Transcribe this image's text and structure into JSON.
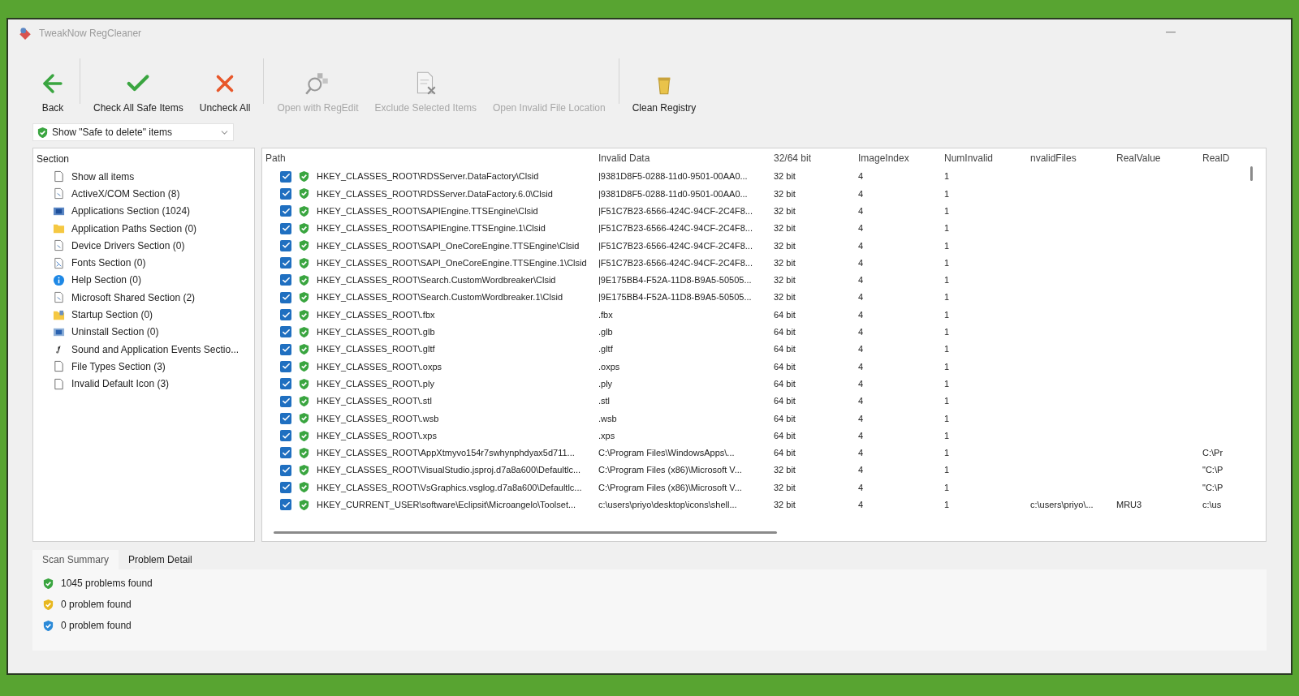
{
  "window": {
    "title": "TweakNow RegCleaner"
  },
  "toolbar": [
    {
      "label": "Back",
      "disabled": false
    },
    {
      "label": "Check All Safe Items",
      "disabled": false
    },
    {
      "label": "Uncheck All",
      "disabled": false
    },
    {
      "label": "Open with RegEdit",
      "disabled": true
    },
    {
      "label": "Exclude Selected Items",
      "disabled": true
    },
    {
      "label": "Open Invalid File Location",
      "disabled": true
    },
    {
      "label": "Clean Registry",
      "disabled": false
    }
  ],
  "filter": {
    "value": "Show \"Safe to delete\" items"
  },
  "sections": {
    "header": "Section",
    "items": [
      {
        "label": "Show all items"
      },
      {
        "label": "ActiveX/COM Section (8)"
      },
      {
        "label": "Applications Section (1024)"
      },
      {
        "label": "Application Paths Section (0)"
      },
      {
        "label": "Device Drivers Section (0)"
      },
      {
        "label": "Fonts Section (0)"
      },
      {
        "label": "Help Section (0)"
      },
      {
        "label": "Microsoft Shared Section (2)"
      },
      {
        "label": "Startup Section (0)"
      },
      {
        "label": "Uninstall Section (0)"
      },
      {
        "label": "Sound and Application Events Sectio..."
      },
      {
        "label": "File Types Section (3)"
      },
      {
        "label": "Invalid Default Icon (3)"
      }
    ]
  },
  "table": {
    "columns": [
      "Path",
      "Invalid Data",
      "32/64 bit",
      "ImageIndex",
      "NumInvalid",
      "nvalidFiles",
      "RealValue",
      "RealD"
    ],
    "rows": [
      {
        "checked": true,
        "path": "HKEY_CLASSES_ROOT\\RDSServer.DataFactory\\Clsid",
        "invalid_data": "|9381D8F5-0288-11d0-9501-00AA0...",
        "bitness": "32 bit",
        "image_index": "4",
        "num_invalid": "1"
      },
      {
        "checked": true,
        "path": "HKEY_CLASSES_ROOT\\RDSServer.DataFactory.6.0\\Clsid",
        "invalid_data": "|9381D8F5-0288-11d0-9501-00AA0...",
        "bitness": "32 bit",
        "image_index": "4",
        "num_invalid": "1"
      },
      {
        "checked": true,
        "path": "HKEY_CLASSES_ROOT\\SAPIEngine.TTSEngine\\Clsid",
        "invalid_data": "|F51C7B23-6566-424C-94CF-2C4F8...",
        "bitness": "32 bit",
        "image_index": "4",
        "num_invalid": "1"
      },
      {
        "checked": true,
        "path": "HKEY_CLASSES_ROOT\\SAPIEngine.TTSEngine.1\\Clsid",
        "invalid_data": "|F51C7B23-6566-424C-94CF-2C4F8...",
        "bitness": "32 bit",
        "image_index": "4",
        "num_invalid": "1"
      },
      {
        "checked": true,
        "path": "HKEY_CLASSES_ROOT\\SAPI_OneCoreEngine.TTSEngine\\Clsid",
        "invalid_data": "|F51C7B23-6566-424C-94CF-2C4F8...",
        "bitness": "32 bit",
        "image_index": "4",
        "num_invalid": "1"
      },
      {
        "checked": true,
        "path": "HKEY_CLASSES_ROOT\\SAPI_OneCoreEngine.TTSEngine.1\\Clsid",
        "invalid_data": "|F51C7B23-6566-424C-94CF-2C4F8...",
        "bitness": "32 bit",
        "image_index": "4",
        "num_invalid": "1"
      },
      {
        "checked": true,
        "path": "HKEY_CLASSES_ROOT\\Search.CustomWordbreaker\\Clsid",
        "invalid_data": "|9E175BB4-F52A-11D8-B9A5-50505...",
        "bitness": "32 bit",
        "image_index": "4",
        "num_invalid": "1"
      },
      {
        "checked": true,
        "path": "HKEY_CLASSES_ROOT\\Search.CustomWordbreaker.1\\Clsid",
        "invalid_data": "|9E175BB4-F52A-11D8-B9A5-50505...",
        "bitness": "32 bit",
        "image_index": "4",
        "num_invalid": "1"
      },
      {
        "checked": true,
        "path": "HKEY_CLASSES_ROOT\\.fbx",
        "invalid_data": ".fbx",
        "bitness": "64 bit",
        "image_index": "4",
        "num_invalid": "1"
      },
      {
        "checked": true,
        "path": "HKEY_CLASSES_ROOT\\.glb",
        "invalid_data": ".glb",
        "bitness": "64 bit",
        "image_index": "4",
        "num_invalid": "1"
      },
      {
        "checked": true,
        "path": "HKEY_CLASSES_ROOT\\.gltf",
        "invalid_data": ".gltf",
        "bitness": "64 bit",
        "image_index": "4",
        "num_invalid": "1"
      },
      {
        "checked": true,
        "path": "HKEY_CLASSES_ROOT\\.oxps",
        "invalid_data": ".oxps",
        "bitness": "64 bit",
        "image_index": "4",
        "num_invalid": "1"
      },
      {
        "checked": true,
        "path": "HKEY_CLASSES_ROOT\\.ply",
        "invalid_data": ".ply",
        "bitness": "64 bit",
        "image_index": "4",
        "num_invalid": "1"
      },
      {
        "checked": true,
        "path": "HKEY_CLASSES_ROOT\\.stl",
        "invalid_data": ".stl",
        "bitness": "64 bit",
        "image_index": "4",
        "num_invalid": "1"
      },
      {
        "checked": true,
        "path": "HKEY_CLASSES_ROOT\\.wsb",
        "invalid_data": ".wsb",
        "bitness": "64 bit",
        "image_index": "4",
        "num_invalid": "1"
      },
      {
        "checked": true,
        "path": "HKEY_CLASSES_ROOT\\.xps",
        "invalid_data": ".xps",
        "bitness": "64 bit",
        "image_index": "4",
        "num_invalid": "1"
      },
      {
        "checked": true,
        "path": "HKEY_CLASSES_ROOT\\AppXtmyvo154r7swhynphdyax5d711...",
        "invalid_data": "C:\\Program Files\\WindowsApps\\...",
        "bitness": "64 bit",
        "image_index": "4",
        "num_invalid": "1",
        "column_8": "C:\\Pr"
      },
      {
        "checked": true,
        "path": "HKEY_CLASSES_ROOT\\VisualStudio.jsproj.d7a8a600\\Defaultlc...",
        "invalid_data": "C:\\Program Files (x86)\\Microsoft V...",
        "bitness": "32 bit",
        "image_index": "4",
        "num_invalid": "1",
        "column_8": "\"C:\\P"
      },
      {
        "checked": true,
        "path": "HKEY_CLASSES_ROOT\\VsGraphics.vsglog.d7a8a600\\Defaultlc...",
        "invalid_data": "C:\\Program Files (x86)\\Microsoft V...",
        "bitness": "32 bit",
        "image_index": "4",
        "num_invalid": "1",
        "column_8": "\"C:\\P"
      },
      {
        "checked": true,
        "path": "HKEY_CURRENT_USER\\software\\Eclipsit\\Microangelo\\Toolset...",
        "invalid_data": "c:\\users\\priyo\\desktop\\icons\\shell...",
        "bitness": "32 bit",
        "image_index": "4",
        "num_invalid": "1",
        "invalid_files": "c:\\users\\priyo\\...",
        "real_value": "MRU3",
        "column_8": "c:\\us"
      }
    ]
  },
  "bottom_tabs": [
    {
      "label": "Scan Summary",
      "selected": true
    },
    {
      "label": "Problem Detail",
      "selected": false
    }
  ],
  "summary": [
    {
      "kind": "safe",
      "text": "1045 problems found"
    },
    {
      "kind": "caution",
      "text": "0 problem found"
    },
    {
      "kind": "info",
      "text": "0 problem found"
    }
  ]
}
